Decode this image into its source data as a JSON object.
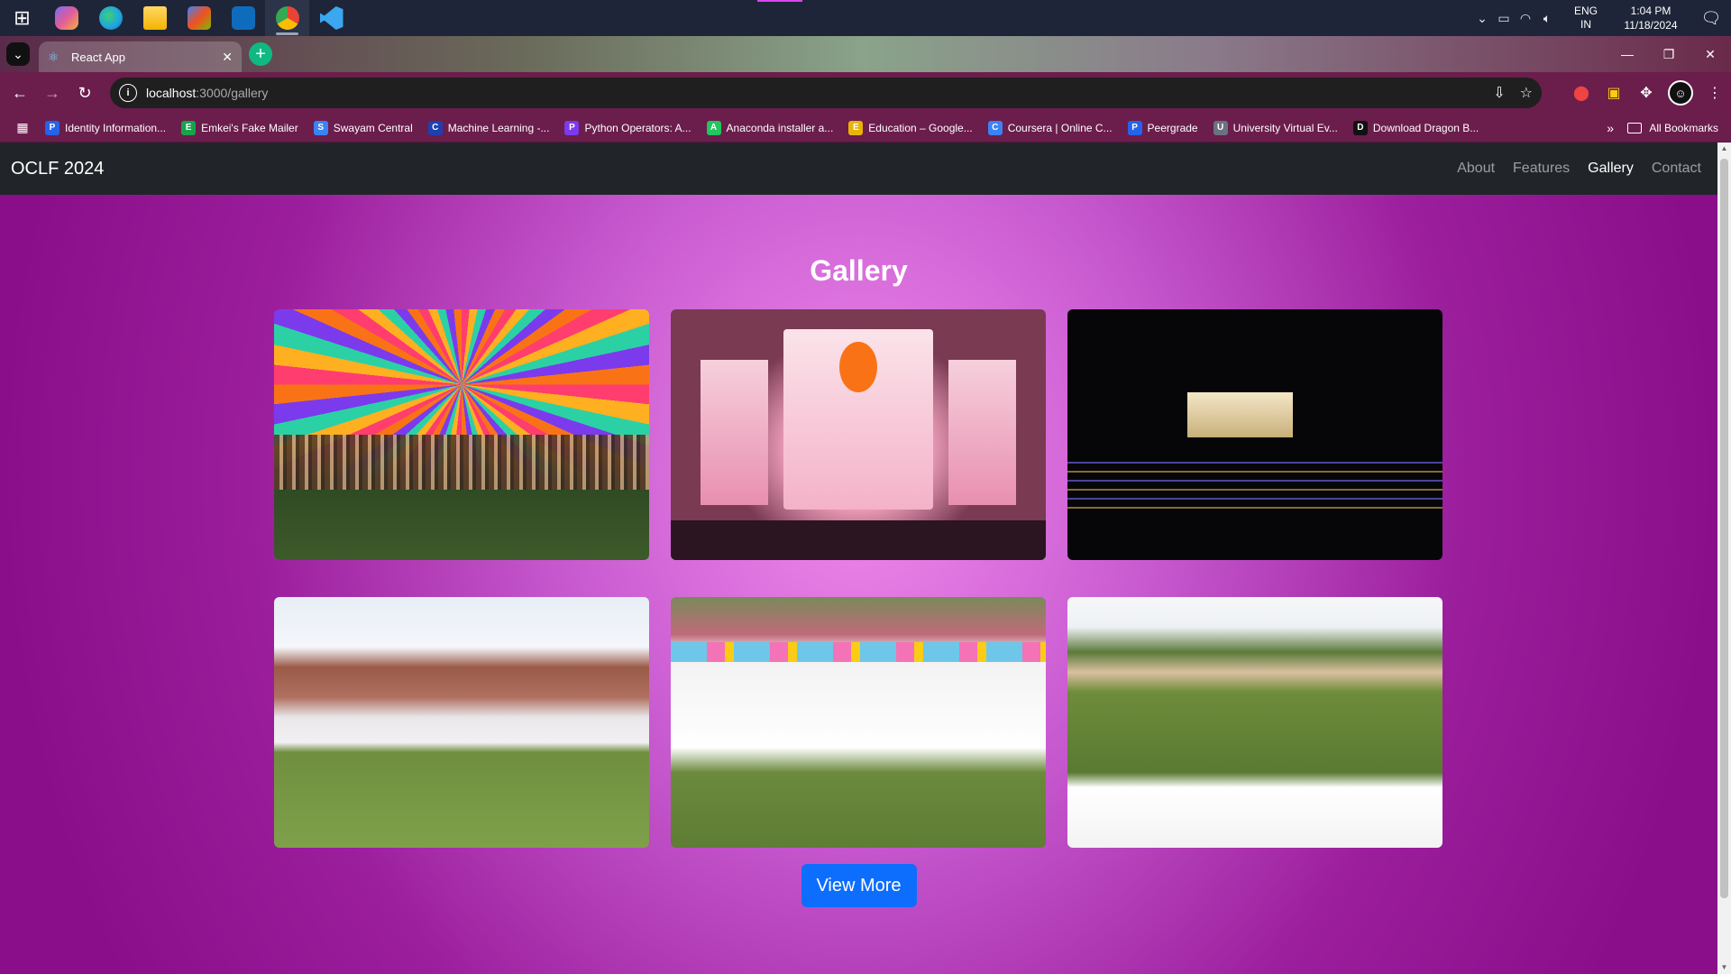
{
  "taskbar": {
    "apps": [
      {
        "name": "start",
        "glyph": "⊞",
        "color": "#ffffff"
      },
      {
        "name": "copilot",
        "glyph": "",
        "color": "#7c6cf0"
      },
      {
        "name": "edge",
        "glyph": "",
        "color": "#1fa3e3"
      },
      {
        "name": "file-explorer",
        "glyph": "",
        "color": "#f4c542"
      },
      {
        "name": "store",
        "glyph": "",
        "color": "#3b82f6"
      },
      {
        "name": "outlook",
        "glyph": "",
        "color": "#0f6cbd"
      },
      {
        "name": "chrome",
        "glyph": "",
        "color": "#34a853"
      },
      {
        "name": "vscode",
        "glyph": "",
        "color": "#3aa7f0"
      }
    ],
    "lang_line1": "ENG",
    "lang_line2": "IN",
    "time": "1:04 PM",
    "date": "11/18/2024"
  },
  "browser": {
    "tab_title": "React App",
    "url_host": "localhost",
    "url_path": ":3000/gallery",
    "bookmarks": [
      {
        "label": "Identity Information...",
        "icon_color": "#2563eb",
        "letter": "P"
      },
      {
        "label": "Emkei's Fake Mailer",
        "icon_color": "#16a34a",
        "letter": "E"
      },
      {
        "label": "Swayam Central",
        "icon_color": "#3b82f6",
        "letter": "S"
      },
      {
        "label": "Machine Learning -...",
        "icon_color": "#1e40af",
        "letter": "C"
      },
      {
        "label": "Python Operators: A...",
        "icon_color": "#7c3aed",
        "letter": "P"
      },
      {
        "label": "Anaconda installer a...",
        "icon_color": "#22c55e",
        "letter": "A"
      },
      {
        "label": "Education – Google...",
        "icon_color": "#eab308",
        "letter": "E"
      },
      {
        "label": "Coursera | Online C...",
        "icon_color": "#3b82f6",
        "letter": "C"
      },
      {
        "label": "Peergrade",
        "icon_color": "#2563eb",
        "letter": "P"
      },
      {
        "label": "University Virtual Ev...",
        "icon_color": "#6b7280",
        "letter": "U"
      },
      {
        "label": "Download Dragon B...",
        "icon_color": "#111111",
        "letter": "D"
      }
    ],
    "all_bookmarks": "All Bookmarks"
  },
  "navbar": {
    "brand": "OCLF 2024",
    "links": [
      "About",
      "Features",
      "Gallery",
      "Contact"
    ],
    "active": "Gallery"
  },
  "gallery": {
    "title": "Gallery",
    "photos": [
      {
        "name": "colorful-canopy-audience"
      },
      {
        "name": "orange-city-literature-fest-stage"
      },
      {
        "name": "night-stage-lights"
      },
      {
        "name": "lawn-stalls-balloons"
      },
      {
        "name": "white-stalls-colorful-drapes"
      },
      {
        "name": "garden-overview"
      }
    ],
    "button_label": "View More"
  },
  "colors": {
    "accent": "#0d6efd",
    "navbar_bg": "#212529",
    "page_gradient_center": "#f08aec",
    "page_gradient_edge": "#8a0e8a"
  }
}
